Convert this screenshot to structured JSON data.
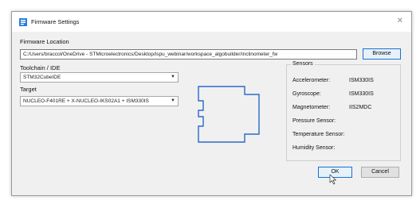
{
  "window": {
    "title": "Firmware Settings",
    "close_glyph": "✕"
  },
  "firmware_location": {
    "label": "Firmware Location",
    "path": "C:/Users/braccol/OneDrive - STMicroelectronics/Desktop/ispu_webinar/workspace_algobuilder/inclinometer_fw",
    "browse_label": "Browse"
  },
  "toolchain": {
    "label": "Toolchain / IDE",
    "value": "STM32CubeIDE"
  },
  "target": {
    "label": "Target",
    "value": "NUCLEO-F401RE + X-NUCLEO-IKS02A1 + ISM330IS"
  },
  "sensors": {
    "title": "Sensors",
    "items": [
      {
        "name": "Accelerometer:",
        "value": "ISM330IS"
      },
      {
        "name": "Gyroscope:",
        "value": "ISM330IS"
      },
      {
        "name": "Magnetometer:",
        "value": "IIS2MDC"
      },
      {
        "name": "Pressure Sensor:",
        "value": ""
      },
      {
        "name": "Temperature Sensor:",
        "value": ""
      },
      {
        "name": "Humidity Sensor:",
        "value": ""
      }
    ]
  },
  "buttons": {
    "ok": "OK",
    "cancel": "Cancel"
  },
  "colors": {
    "accent": "#1e6fcf",
    "board_outline": "#2a6ac7",
    "dialog_bg": "#f0f0f0"
  },
  "icons": [
    "app-icon",
    "close-icon",
    "dropdown-arrow-icon",
    "board-outline-icon",
    "mouse-cursor-icon"
  ]
}
